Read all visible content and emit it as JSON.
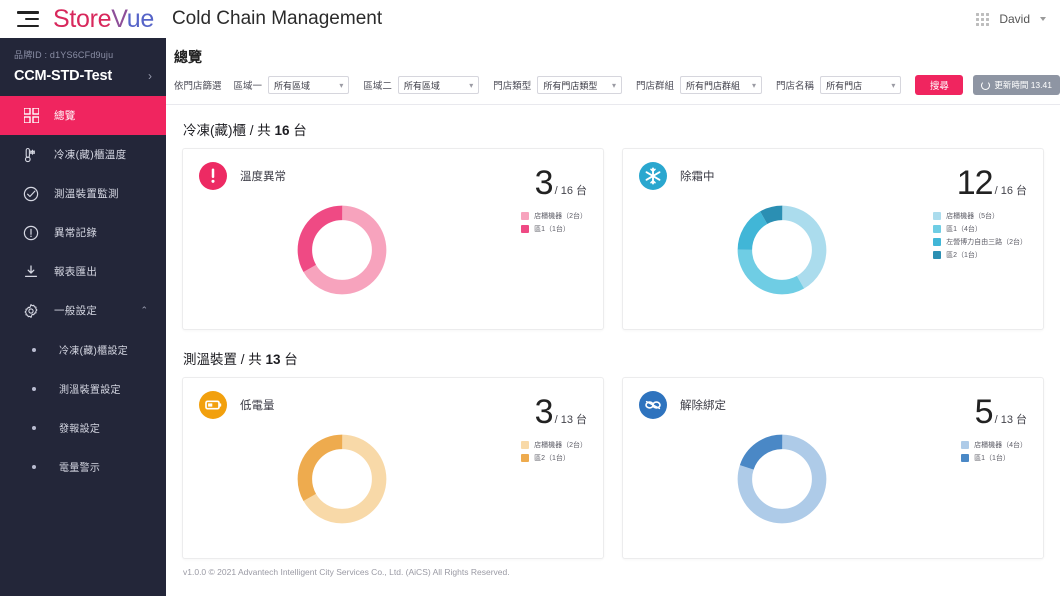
{
  "header": {
    "menu_icon": "hamburger-icon",
    "logo_part1": "Store",
    "logo_part2": "V",
    "logo_part3": "ue",
    "app_title": "Cold Chain Management",
    "apps_icon": "grid-apps-icon",
    "user_name": "David",
    "user_caret_icon": "chevron-down-icon"
  },
  "sidebar": {
    "brand_id_label": "品牌ID : d1YS6CFd9uju",
    "brand_name": "CCM-STD-Test",
    "brand_arrow": "›",
    "items": [
      {
        "label": "總覽",
        "icon": "dashboard-grid-icon",
        "active": true
      },
      {
        "label": "冷凍(藏)櫃溫度",
        "icon": "thermometer-icon",
        "active": false
      },
      {
        "label": "測溫裝置監測",
        "icon": "target-check-icon",
        "active": false
      },
      {
        "label": "異常記錄",
        "icon": "alert-circle-icon",
        "active": false
      },
      {
        "label": "報表匯出",
        "icon": "download-icon",
        "active": false
      },
      {
        "label": "一般設定",
        "icon": "gear-icon",
        "active": false,
        "expanded": true,
        "chevron": "⌃"
      }
    ],
    "sub_items": [
      {
        "label": "冷凍(藏)櫃設定"
      },
      {
        "label": "測溫裝置設定"
      },
      {
        "label": "發報設定"
      },
      {
        "label": "電量警示"
      }
    ]
  },
  "filters": {
    "page_title": "總覽",
    "prefix_label": "依門店篩選",
    "fields": [
      {
        "label": "區域一",
        "value": "所有區域"
      },
      {
        "label": "區域二",
        "value": "所有區域"
      },
      {
        "label": "門店類型",
        "value": "所有門店類型"
      },
      {
        "label": "門店群組",
        "value": "所有門店群組"
      },
      {
        "label": "門店名稱",
        "value": "所有門店"
      }
    ],
    "search_button": "搜尋",
    "refresh_label": "更新時間 13.41",
    "refresh_icon": "refresh-icon"
  },
  "sections": [
    {
      "title_prefix": "冷凍(藏)櫃 / 共 ",
      "title_count": "16",
      "title_suffix": " 台",
      "cards": [
        {
          "title": "溫度異常",
          "icon": "alert-exclamation-icon",
          "badge_color": "#ed2a63",
          "value": "3",
          "total": "/ 16 台",
          "chart_data": {
            "type": "pie",
            "title": "溫度異常",
            "categories": [
              "店櫃機器（2台）",
              "區1（1台）"
            ],
            "values": [
              2,
              1
            ],
            "colors": [
              "#f7a3bd",
              "#ef4a84"
            ],
            "total": 3,
            "denominator": 16,
            "legend_position": "right"
          }
        },
        {
          "title": "除霜中",
          "icon": "snowflake-icon",
          "badge_color": "#2aa7cf",
          "value": "12",
          "total": "/ 16 台",
          "chart_data": {
            "type": "pie",
            "title": "除霜中",
            "categories": [
              "店櫃機器（5台）",
              "區1（4台）",
              "左營博力自由三路（2台）",
              "區2（1台）"
            ],
            "values": [
              5,
              4,
              2,
              1
            ],
            "colors": [
              "#abdced",
              "#6fcde4",
              "#41b6d7",
              "#2b8fb3"
            ],
            "total": 12,
            "denominator": 16,
            "legend_position": "right"
          }
        }
      ]
    },
    {
      "title_prefix": "測溫裝置 / 共 ",
      "title_count": "13",
      "title_suffix": " 台",
      "cards": [
        {
          "title": "低電量",
          "icon": "battery-low-icon",
          "badge_color": "#f2a00d",
          "value": "3",
          "total": "/ 13 台",
          "chart_data": {
            "type": "pie",
            "title": "低電量",
            "categories": [
              "店櫃機器（2台）",
              "區2（1台）"
            ],
            "values": [
              2,
              1
            ],
            "colors": [
              "#f8d9a8",
              "#eeab4e"
            ],
            "total": 3,
            "denominator": 13,
            "legend_position": "right"
          }
        },
        {
          "title": "解除綁定",
          "icon": "broken-link-icon",
          "badge_color": "#2e73be",
          "value": "5",
          "total": "/ 13 台",
          "chart_data": {
            "type": "pie",
            "title": "解除綁定",
            "categories": [
              "店櫃機器（4台）",
              "區1（1台）"
            ],
            "values": [
              4,
              1
            ],
            "colors": [
              "#aecbe8",
              "#4a88c6"
            ],
            "total": 5,
            "denominator": 13,
            "legend_position": "right"
          }
        }
      ]
    }
  ],
  "footer": {
    "copyright": "v1.0.0 © 2021 Advantech Intelligent City Services Co., Ltd. (AiCS) All Rights Reserved."
  }
}
